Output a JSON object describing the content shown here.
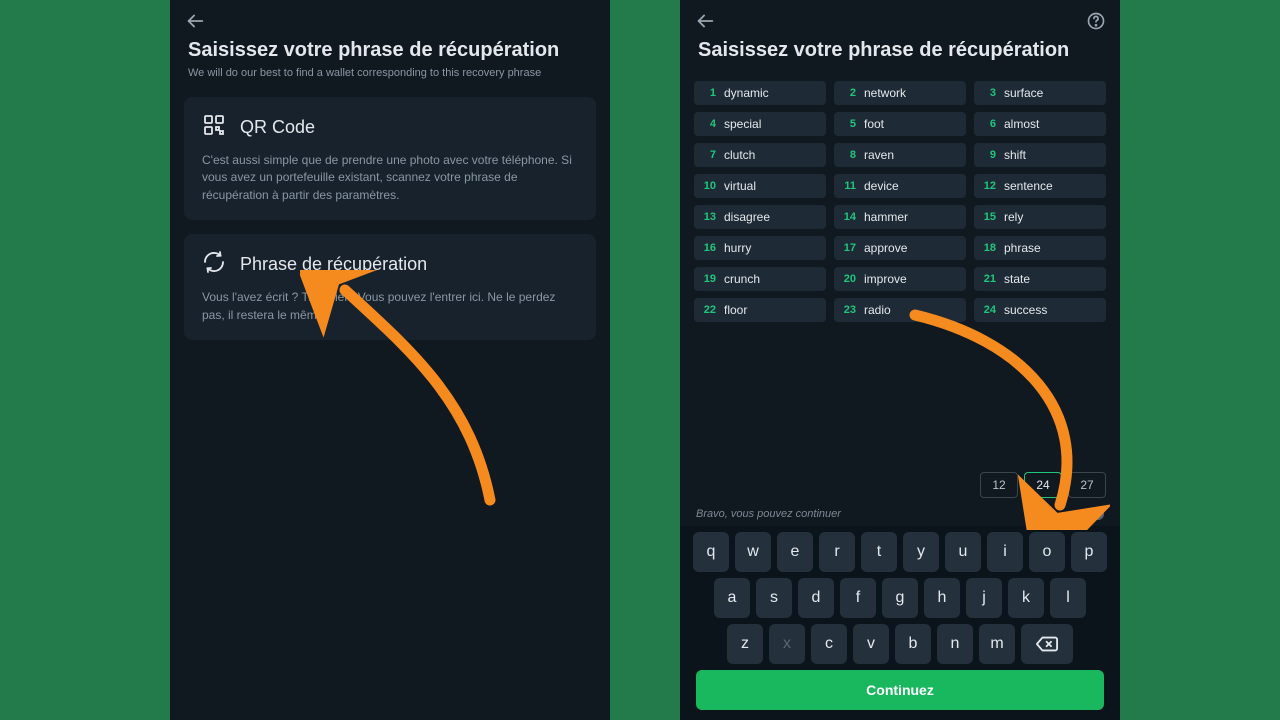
{
  "left": {
    "title": "Saisissez votre phrase de récupération",
    "subtitle": "We will do our best to find a wallet corresponding to this recovery phrase",
    "card_qr": {
      "label": "QR Code",
      "body": "C'est aussi simple que de prendre une photo avec votre téléphone. Si vous avez un portefeuille existant, scannez votre phrase de récupération à partir des paramètres."
    },
    "card_phrase": {
      "label": "Phrase de récupération",
      "body": "Vous l'avez écrit ? Très bien. Vous pouvez l'entrer ici. Ne le perdez pas, il restera le même."
    }
  },
  "right": {
    "title": "Saisissez votre phrase de récupération",
    "words": [
      {
        "i": 1,
        "w": "dynamic"
      },
      {
        "i": 2,
        "w": "network"
      },
      {
        "i": 3,
        "w": "surface"
      },
      {
        "i": 4,
        "w": "special"
      },
      {
        "i": 5,
        "w": "foot"
      },
      {
        "i": 6,
        "w": "almost"
      },
      {
        "i": 7,
        "w": "clutch"
      },
      {
        "i": 8,
        "w": "raven"
      },
      {
        "i": 9,
        "w": "shift"
      },
      {
        "i": 10,
        "w": "virtual"
      },
      {
        "i": 11,
        "w": "device"
      },
      {
        "i": 12,
        "w": "sentence"
      },
      {
        "i": 13,
        "w": "disagree"
      },
      {
        "i": 14,
        "w": "hammer"
      },
      {
        "i": 15,
        "w": "rely"
      },
      {
        "i": 16,
        "w": "hurry"
      },
      {
        "i": 17,
        "w": "approve"
      },
      {
        "i": 18,
        "w": "phrase"
      },
      {
        "i": 19,
        "w": "crunch"
      },
      {
        "i": 20,
        "w": "improve"
      },
      {
        "i": 21,
        "w": "state"
      },
      {
        "i": 22,
        "w": "floor"
      },
      {
        "i": 23,
        "w": "radio"
      },
      {
        "i": 24,
        "w": "success"
      }
    ],
    "lengths": {
      "opt1": "12",
      "opt2": "24",
      "opt3": "27",
      "active": "24"
    },
    "status": "Bravo, vous pouvez continuer",
    "keyboard": {
      "row1": [
        "q",
        "w",
        "e",
        "r",
        "t",
        "y",
        "u",
        "i",
        "o",
        "p"
      ],
      "row2": [
        "a",
        "s",
        "d",
        "f",
        "g",
        "h",
        "j",
        "k",
        "l"
      ],
      "row3": [
        "z",
        "x",
        "c",
        "v",
        "b",
        "n",
        "m"
      ],
      "muted": [
        "x"
      ]
    },
    "cta": "Continuez"
  },
  "colors": {
    "accent": "#1fc77c",
    "arrow": "#f58a1e"
  }
}
